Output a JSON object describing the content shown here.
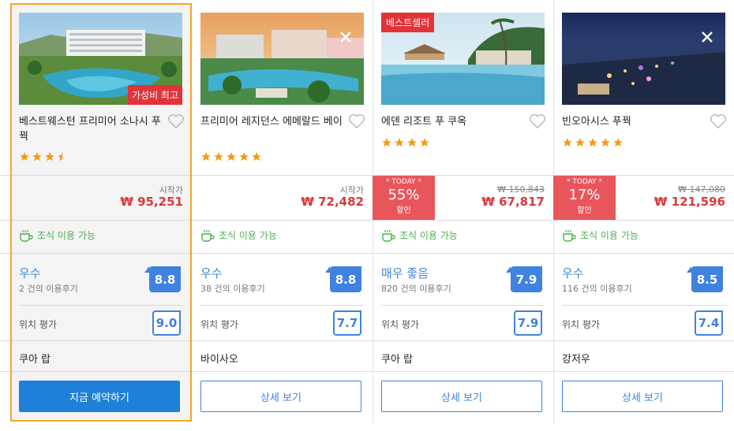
{
  "colors": {
    "highlight_border": "#f5a623",
    "price_red": "#d93a3a",
    "breakfast_green": "#4caf50",
    "score_blue": "#3f82e0",
    "primary_button": "#1e80d8",
    "star": "#f59a10",
    "tag_red": "#e2333b"
  },
  "hotels": [
    {
      "name": "베스트웨스턴 프리미어 소나시 푸꿕",
      "badge": "가성비 최고",
      "stars": 3.5,
      "from_label": "시작가",
      "price": "₩ 95,251",
      "breakfast": "조식 이용 가능",
      "rating_word": "우수",
      "reviews": "2 건의 이용후기",
      "score": "8.8",
      "location_label": "위치 평가",
      "location_score": "9.0",
      "area": "쿠아 랍",
      "button": "지금 예약하기",
      "icons": [
        "heart-icon",
        "breakfast-cup-icon"
      ]
    },
    {
      "name": "프리미어 레지던스 에메랄드 베이",
      "stars": 5,
      "from_label": "시작가",
      "price": "₩ 72,482",
      "breakfast": "조식 이용 가능",
      "rating_word": "우수",
      "reviews": "38 건의 이용후기",
      "score": "8.8",
      "location_label": "위치 평가",
      "location_score": "7.7",
      "area": "바이사오",
      "button": "상세 보기",
      "icons": [
        "close-icon",
        "heart-icon",
        "breakfast-cup-icon"
      ]
    },
    {
      "name": "에덴 리조트 푸 쿠옥",
      "badge": "베스트셀러",
      "stars": 4,
      "today_label": "* TODAY *",
      "discount": "55%",
      "discount_label": "할인",
      "original_price": "₩ 150,843",
      "price": "₩ 67,817",
      "breakfast": "조식 이용 가능",
      "rating_word": "매우 좋음",
      "reviews": "820 건의 이용후기",
      "score": "7.9",
      "location_label": "위치 평가",
      "location_score": "7.9",
      "area": "쿠아 랍",
      "button": "상세 보기",
      "icons": [
        "heart-icon",
        "breakfast-cup-icon"
      ]
    },
    {
      "name": "빈오아시스 푸꿕",
      "stars": 5,
      "today_label": "* TODAY *",
      "discount": "17%",
      "discount_label": "할인",
      "original_price": "₩ 147,080",
      "price": "₩ 121,596",
      "breakfast": "조식 이용 가능",
      "rating_word": "우수",
      "reviews": "116 건의 이용후기",
      "score": "8.5",
      "location_label": "위치 평가",
      "location_score": "7.4",
      "area": "강저우",
      "button": "상세 보기",
      "icons": [
        "close-icon",
        "heart-icon",
        "breakfast-cup-icon"
      ]
    }
  ]
}
